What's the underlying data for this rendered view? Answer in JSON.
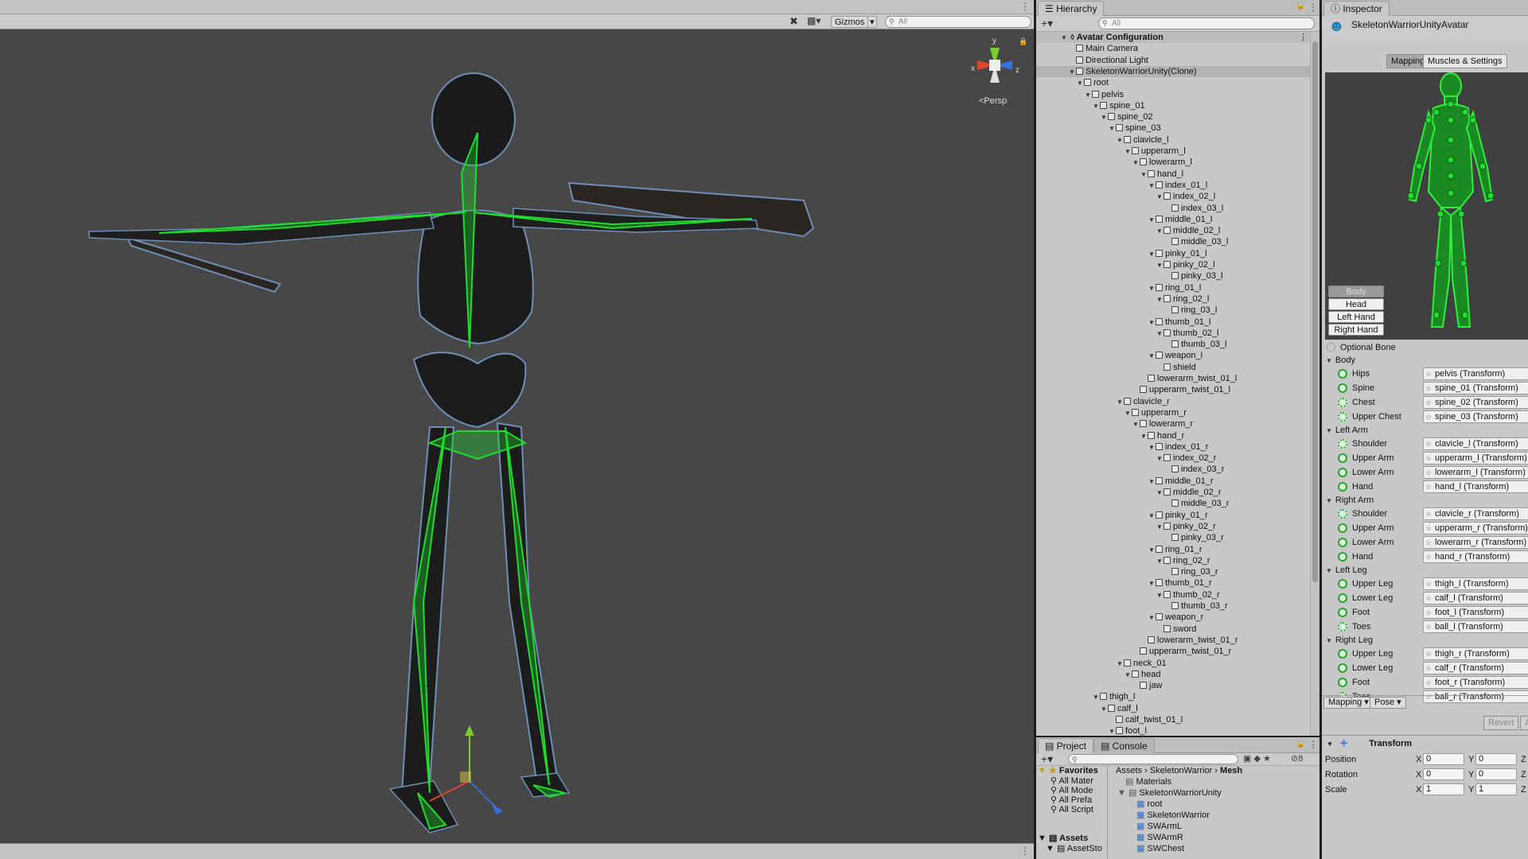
{
  "scene": {
    "gizmos_label": "Gizmos",
    "search_placeholder": "All",
    "persp_label": "<Persp",
    "axis_x": "x",
    "axis_y": "y",
    "axis_z": "z"
  },
  "hierarchy": {
    "tab_label": "Hierarchy",
    "search_placeholder": "All",
    "scene_name": "Avatar Configuration",
    "rows": [
      {
        "label": "Main Camera",
        "depth": 1,
        "arrow": false
      },
      {
        "label": "Directional Light",
        "depth": 1,
        "arrow": false
      },
      {
        "label": "SkeletonWarriorUnity(Clone)",
        "depth": 1,
        "arrow": true,
        "selected": true
      },
      {
        "label": "root",
        "depth": 2,
        "arrow": true
      },
      {
        "label": "pelvis",
        "depth": 3,
        "arrow": true
      },
      {
        "label": "spine_01",
        "depth": 4,
        "arrow": true
      },
      {
        "label": "spine_02",
        "depth": 5,
        "arrow": true
      },
      {
        "label": "spine_03",
        "depth": 6,
        "arrow": true
      },
      {
        "label": "clavicle_l",
        "depth": 7,
        "arrow": true
      },
      {
        "label": "upperarm_l",
        "depth": 8,
        "arrow": true
      },
      {
        "label": "lowerarm_l",
        "depth": 9,
        "arrow": true
      },
      {
        "label": "hand_l",
        "depth": 10,
        "arrow": true
      },
      {
        "label": "index_01_l",
        "depth": 11,
        "arrow": true
      },
      {
        "label": "index_02_l",
        "depth": 12,
        "arrow": true
      },
      {
        "label": "index_03_l",
        "depth": 13,
        "arrow": false
      },
      {
        "label": "middle_01_l",
        "depth": 11,
        "arrow": true
      },
      {
        "label": "middle_02_l",
        "depth": 12,
        "arrow": true
      },
      {
        "label": "middle_03_l",
        "depth": 13,
        "arrow": false
      },
      {
        "label": "pinky_01_l",
        "depth": 11,
        "arrow": true
      },
      {
        "label": "pinky_02_l",
        "depth": 12,
        "arrow": true
      },
      {
        "label": "pinky_03_l",
        "depth": 13,
        "arrow": false
      },
      {
        "label": "ring_01_l",
        "depth": 11,
        "arrow": true
      },
      {
        "label": "ring_02_l",
        "depth": 12,
        "arrow": true
      },
      {
        "label": "ring_03_l",
        "depth": 13,
        "arrow": false
      },
      {
        "label": "thumb_01_l",
        "depth": 11,
        "arrow": true
      },
      {
        "label": "thumb_02_l",
        "depth": 12,
        "arrow": true
      },
      {
        "label": "thumb_03_l",
        "depth": 13,
        "arrow": false
      },
      {
        "label": "weapon_l",
        "depth": 11,
        "arrow": true
      },
      {
        "label": "shield",
        "depth": 12,
        "arrow": false
      },
      {
        "label": "lowerarm_twist_01_l",
        "depth": 10,
        "arrow": false
      },
      {
        "label": "upperarm_twist_01_l",
        "depth": 9,
        "arrow": false
      },
      {
        "label": "clavicle_r",
        "depth": 7,
        "arrow": true
      },
      {
        "label": "upperarm_r",
        "depth": 8,
        "arrow": true
      },
      {
        "label": "lowerarm_r",
        "depth": 9,
        "arrow": true
      },
      {
        "label": "hand_r",
        "depth": 10,
        "arrow": true
      },
      {
        "label": "index_01_r",
        "depth": 11,
        "arrow": true
      },
      {
        "label": "index_02_r",
        "depth": 12,
        "arrow": true
      },
      {
        "label": "index_03_r",
        "depth": 13,
        "arrow": false
      },
      {
        "label": "middle_01_r",
        "depth": 11,
        "arrow": true
      },
      {
        "label": "middle_02_r",
        "depth": 12,
        "arrow": true
      },
      {
        "label": "middle_03_r",
        "depth": 13,
        "arrow": false
      },
      {
        "label": "pinky_01_r",
        "depth": 11,
        "arrow": true
      },
      {
        "label": "pinky_02_r",
        "depth": 12,
        "arrow": true
      },
      {
        "label": "pinky_03_r",
        "depth": 13,
        "arrow": false
      },
      {
        "label": "ring_01_r",
        "depth": 11,
        "arrow": true
      },
      {
        "label": "ring_02_r",
        "depth": 12,
        "arrow": true
      },
      {
        "label": "ring_03_r",
        "depth": 13,
        "arrow": false
      },
      {
        "label": "thumb_01_r",
        "depth": 11,
        "arrow": true
      },
      {
        "label": "thumb_02_r",
        "depth": 12,
        "arrow": true
      },
      {
        "label": "thumb_03_r",
        "depth": 13,
        "arrow": false
      },
      {
        "label": "weapon_r",
        "depth": 11,
        "arrow": true
      },
      {
        "label": "sword",
        "depth": 12,
        "arrow": false
      },
      {
        "label": "lowerarm_twist_01_r",
        "depth": 10,
        "arrow": false
      },
      {
        "label": "upperarm_twist_01_r",
        "depth": 9,
        "arrow": false
      },
      {
        "label": "neck_01",
        "depth": 7,
        "arrow": true
      },
      {
        "label": "head",
        "depth": 8,
        "arrow": true
      },
      {
        "label": "jaw",
        "depth": 9,
        "arrow": false
      },
      {
        "label": "thigh_l",
        "depth": 4,
        "arrow": true
      },
      {
        "label": "calf_l",
        "depth": 5,
        "arrow": true
      },
      {
        "label": "calf_twist_01_l",
        "depth": 6,
        "arrow": false
      },
      {
        "label": "foot_l",
        "depth": 6,
        "arrow": true
      }
    ]
  },
  "project": {
    "tab_project": "Project",
    "tab_console": "Console",
    "hidden_count": "8",
    "favorites_label": "Favorites",
    "favorites": [
      "All Mater",
      "All Mode",
      "All Prefa",
      "All Script"
    ],
    "assets_label": "Assets",
    "assets_children": [
      "AssetSto"
    ],
    "breadcrumb": [
      "Assets",
      "SkeletonWarrior",
      "Mesh"
    ],
    "files": [
      {
        "label": "Materials",
        "indent": 0
      },
      {
        "label": "SkeletonWarriorUnity",
        "indent": 0
      },
      {
        "label": "root",
        "indent": 1
      },
      {
        "label": "SkeletonWarrior",
        "indent": 1
      },
      {
        "label": "SWArmL",
        "indent": 1
      },
      {
        "label": "SWArmR",
        "indent": 1
      },
      {
        "label": "SWChest",
        "indent": 1
      }
    ]
  },
  "inspector": {
    "tab_label": "Inspector",
    "object_name": "SkeletonWarriorUnityAvatar",
    "tab_mapping": "Mapping",
    "tab_muscles": "Muscles & Settings",
    "part_buttons": [
      "Body",
      "Head",
      "Left Hand",
      "Right Hand"
    ],
    "optional_bone": "Optional Bone",
    "groups": [
      {
        "name": "Body",
        "bones": [
          {
            "label": "Hips",
            "value": "pelvis (Transform)",
            "optional": false
          },
          {
            "label": "Spine",
            "value": "spine_01 (Transform)",
            "optional": false
          },
          {
            "label": "Chest",
            "value": "spine_02 (Transform)",
            "optional": true
          },
          {
            "label": "Upper Chest",
            "value": "spine_03 (Transform)",
            "optional": true
          }
        ]
      },
      {
        "name": "Left Arm",
        "bones": [
          {
            "label": "Shoulder",
            "value": "clavicle_l (Transform)",
            "optional": true
          },
          {
            "label": "Upper Arm",
            "value": "upperarm_l (Transform)",
            "optional": false
          },
          {
            "label": "Lower Arm",
            "value": "lowerarm_l (Transform)",
            "optional": false
          },
          {
            "label": "Hand",
            "value": "hand_l (Transform)",
            "optional": false
          }
        ]
      },
      {
        "name": "Right Arm",
        "bones": [
          {
            "label": "Shoulder",
            "value": "clavicle_r (Transform)",
            "optional": true
          },
          {
            "label": "Upper Arm",
            "value": "upperarm_r (Transform)",
            "optional": false
          },
          {
            "label": "Lower Arm",
            "value": "lowerarm_r (Transform)",
            "optional": false
          },
          {
            "label": "Hand",
            "value": "hand_r (Transform)",
            "optional": false
          }
        ]
      },
      {
        "name": "Left Leg",
        "bones": [
          {
            "label": "Upper Leg",
            "value": "thigh_l (Transform)",
            "optional": false
          },
          {
            "label": "Lower Leg",
            "value": "calf_l (Transform)",
            "optional": false
          },
          {
            "label": "Foot",
            "value": "foot_l (Transform)",
            "optional": false
          },
          {
            "label": "Toes",
            "value": "ball_l (Transform)",
            "optional": true
          }
        ]
      },
      {
        "name": "Right Leg",
        "bones": [
          {
            "label": "Upper Leg",
            "value": "thigh_r (Transform)",
            "optional": false
          },
          {
            "label": "Lower Leg",
            "value": "calf_r (Transform)",
            "optional": false
          },
          {
            "label": "Foot",
            "value": "foot_r (Transform)",
            "optional": false
          },
          {
            "label": "Toes",
            "value": "ball_r (Transform)",
            "optional": true
          }
        ]
      }
    ],
    "mapping_dropdown": "Mapping",
    "pose_dropdown": "Pose",
    "revert_label": "Revert",
    "apply_label": "Ap",
    "transform_title": "Transform",
    "transform": [
      {
        "label": "Position",
        "x": "0",
        "y": "0"
      },
      {
        "label": "Rotation",
        "x": "0",
        "y": "0"
      },
      {
        "label": "Scale",
        "x": "1",
        "y": "1"
      }
    ],
    "axis_x": "X",
    "axis_y": "Y",
    "axis_z": "Z"
  },
  "colors": {
    "bone_green": "#1fdc2e",
    "scene_bg": "#474747",
    "panel_bg": "#c8c8c8",
    "selection": "#b3b3b3"
  }
}
